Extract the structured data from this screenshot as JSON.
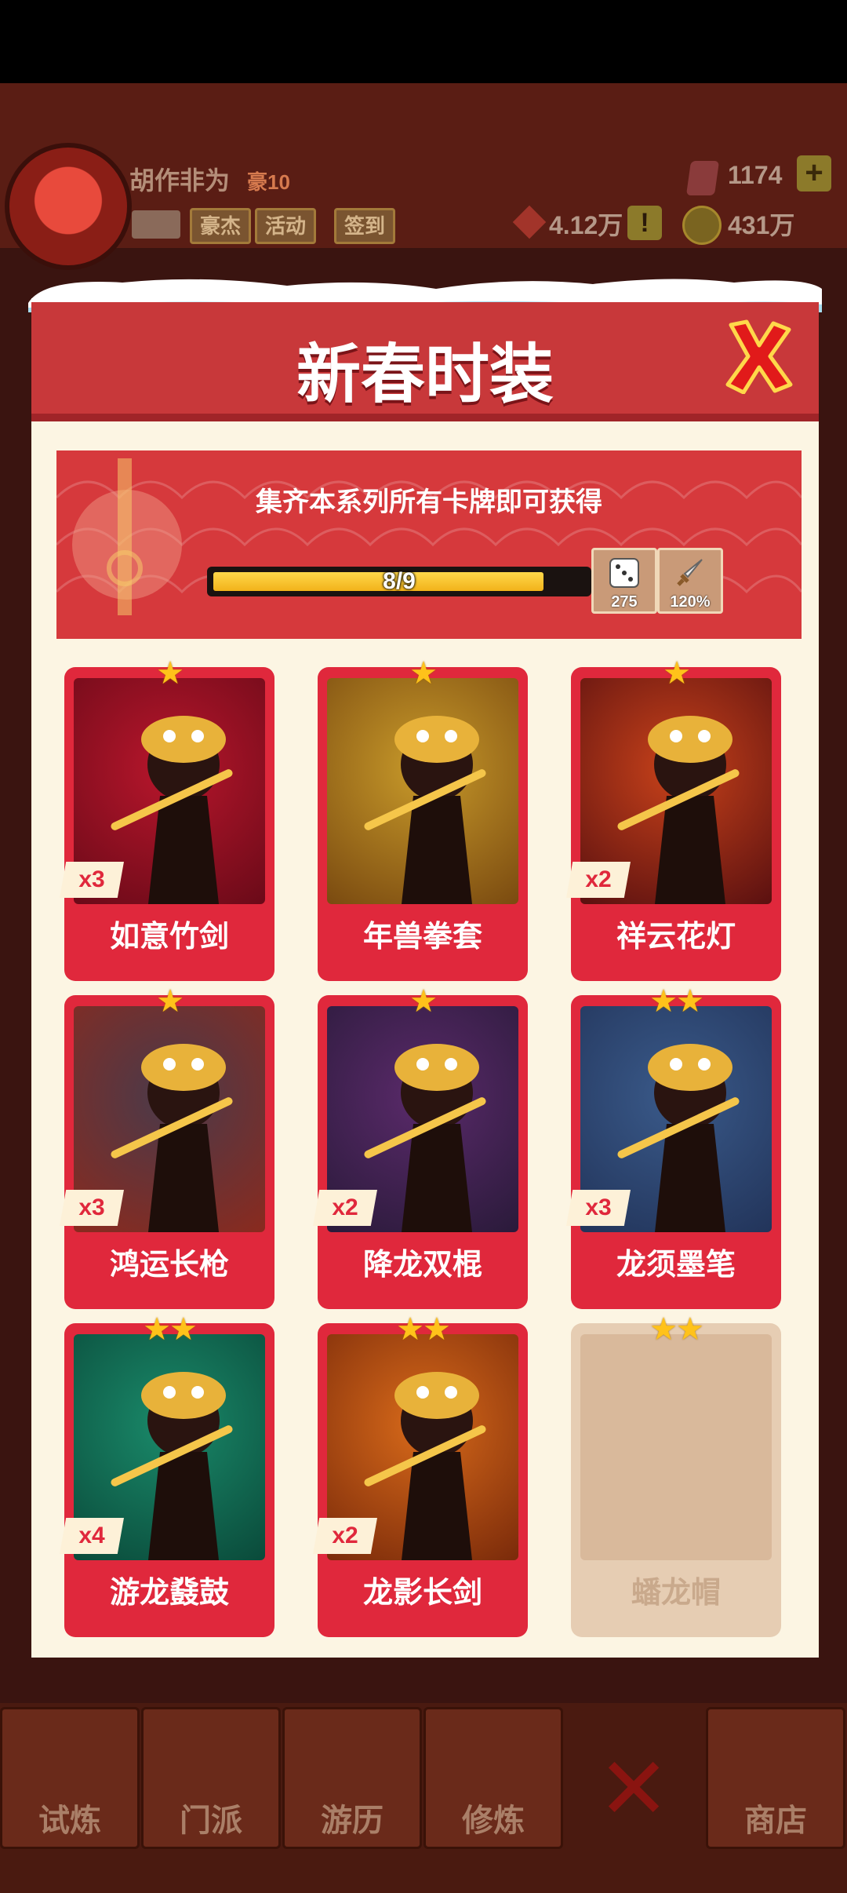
{
  "player": {
    "name": "胡作非为",
    "rank": "豪10"
  },
  "hud": {
    "chips": [
      "豪杰",
      "活动",
      "签到"
    ],
    "gems": "1174",
    "plus": "+",
    "power": "4.12万",
    "alert": "!",
    "coins": "431万"
  },
  "modal": {
    "title": "新春时装",
    "banner_text": "集齐本系列所有卡牌即可获得",
    "progress": {
      "label": "8/9",
      "value": 8,
      "max": 9
    },
    "rewards": [
      {
        "icon": "dice-icon",
        "label": "275"
      },
      {
        "icon": "sword-icon",
        "label": "120%"
      }
    ]
  },
  "cards": [
    {
      "name": "如意竹剑",
      "count": "x3",
      "stars": 1,
      "locked": false,
      "art": [
        "#b8162c",
        "#6a0a18"
      ]
    },
    {
      "name": "年兽拳套",
      "count": "",
      "stars": 1,
      "locked": false,
      "art": [
        "#c89a2a",
        "#7a4a10"
      ]
    },
    {
      "name": "祥云花灯",
      "count": "x2",
      "stars": 1,
      "locked": false,
      "art": [
        "#c8421a",
        "#5a1010"
      ]
    },
    {
      "name": "鸿运长枪",
      "count": "x3",
      "stars": 1,
      "locked": false,
      "art": [
        "#4a3a4a",
        "#8a2a1e"
      ]
    },
    {
      "name": "降龙双棍",
      "count": "x2",
      "stars": 1,
      "locked": false,
      "art": [
        "#5a2a6a",
        "#2a1a3a"
      ]
    },
    {
      "name": "龙须墨笔",
      "count": "x3",
      "stars": 2,
      "locked": false,
      "art": [
        "#3a5a8a",
        "#22345a"
      ]
    },
    {
      "name": "游龙鼗鼓",
      "count": "x4",
      "stars": 2,
      "locked": false,
      "art": [
        "#1a8a6a",
        "#0a4a3a"
      ]
    },
    {
      "name": "龙影长剑",
      "count": "x2",
      "stars": 2,
      "locked": false,
      "art": [
        "#d86a1a",
        "#7a2a0a"
      ]
    },
    {
      "name": "蟠龙帽",
      "count": "",
      "stars": 2,
      "locked": true,
      "art": [
        "#d9b99b",
        "#d9b99b"
      ]
    }
  ],
  "nav": [
    {
      "label": "试炼"
    },
    {
      "label": "门派"
    },
    {
      "label": "游历"
    },
    {
      "label": "修炼"
    },
    {
      "label": "商店"
    }
  ]
}
